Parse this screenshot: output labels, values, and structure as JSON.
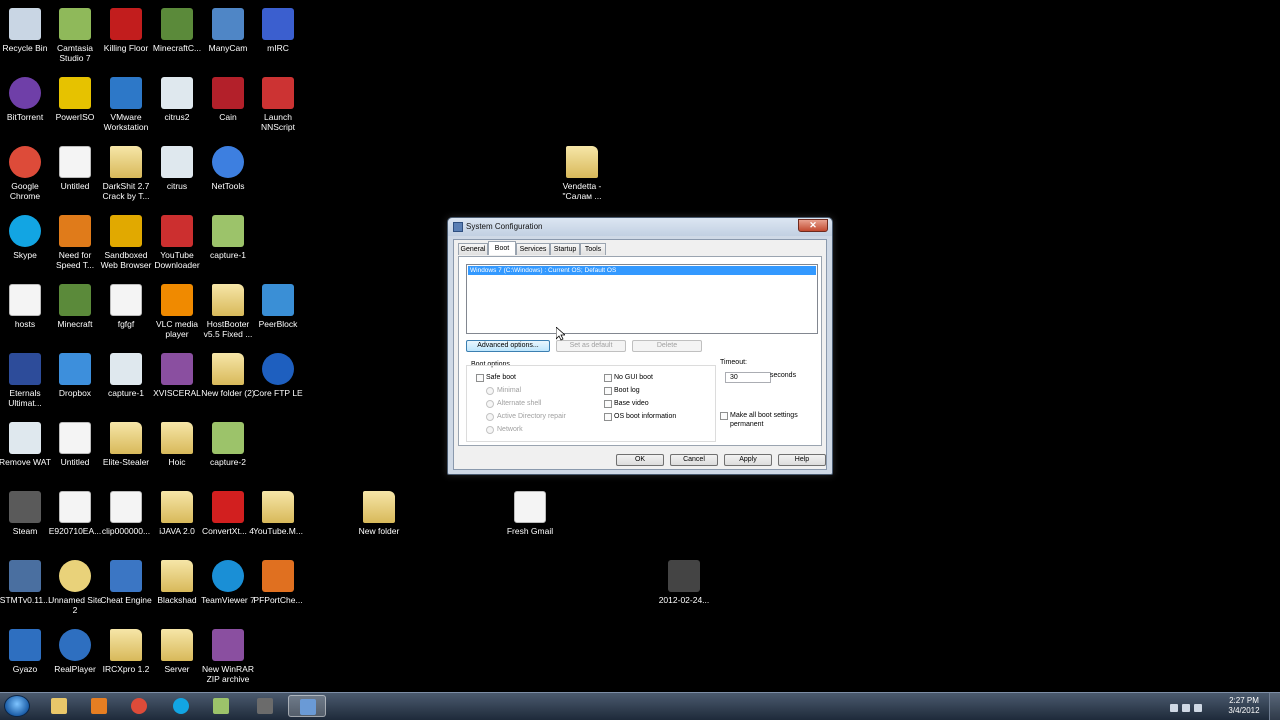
{
  "desktop_icons": [
    {
      "label": "Recycle Bin",
      "icon": "recycle-bin-icon",
      "color": "#c9d6e4"
    },
    {
      "label": "Camtasia Studio 7",
      "icon": "camtasia-icon",
      "color": "#8fb95a"
    },
    {
      "label": "Killing Floor",
      "icon": "killing-floor-icon",
      "color": "#c21d1d"
    },
    {
      "label": "MinecraftC...",
      "icon": "minecraft-icon",
      "color": "#5b8a3a"
    },
    {
      "label": "ManyCam",
      "icon": "manycam-icon",
      "color": "#4f86c6"
    },
    {
      "label": "mIRC",
      "icon": "mirc-icon",
      "color": "#3b5fcf"
    },
    {
      "label": "BitTorrent",
      "icon": "bittorrent-icon",
      "color": "#6f3fa8"
    },
    {
      "label": "PowerISO",
      "icon": "poweriso-icon",
      "color": "#e6c200"
    },
    {
      "label": "VMware Workstation",
      "icon": "vmware-icon",
      "color": "#2d78c8"
    },
    {
      "label": "citrus2",
      "icon": "window-file-icon",
      "color": "#dfe8ee"
    },
    {
      "label": "Cain",
      "icon": "cain-icon",
      "color": "#b3202a"
    },
    {
      "label": "Launch NNScript",
      "icon": "nnscript-icon",
      "color": "#c33"
    },
    {
      "label": "Google Chrome",
      "icon": "chrome-icon",
      "color": "#dd4b39"
    },
    {
      "label": "Untitled",
      "icon": "blank-file-icon",
      "color": "#ffffff"
    },
    {
      "label": "DarkShit 2.7 Crack by T...",
      "icon": "folder-icon",
      "color": "#e9d27a"
    },
    {
      "label": "citrus",
      "icon": "window-file-icon",
      "color": "#dfe8ee"
    },
    {
      "label": "NetTools",
      "icon": "globe-icon",
      "color": "#3d7fe0"
    },
    {
      "label": "Skype",
      "icon": "skype-icon",
      "color": "#12a5e3"
    },
    {
      "label": "Need for Speed T...",
      "icon": "nfs-icon",
      "color": "#e07b1a"
    },
    {
      "label": "Sandboxed Web Browser",
      "icon": "sandboxie-icon",
      "color": "#e1a900"
    },
    {
      "label": "YouTube Downloader",
      "icon": "youtube-downloader-icon",
      "color": "#cc2f2f"
    },
    {
      "label": "capture-1",
      "icon": "video-file-icon",
      "color": "#9cc36a"
    },
    {
      "label": "hosts",
      "icon": "blank-file-icon",
      "color": "#ffffff"
    },
    {
      "label": "Minecraft",
      "icon": "minecraft-icon",
      "color": "#5b8a3a"
    },
    {
      "label": "fgfgf",
      "icon": "blank-file-icon",
      "color": "#ffffff"
    },
    {
      "label": "VLC media player",
      "icon": "vlc-icon",
      "color": "#f08a00"
    },
    {
      "label": "HostBooter v5.5 Fixed ...",
      "icon": "folder-icon",
      "color": "#e9d27a"
    },
    {
      "label": "PeerBlock",
      "icon": "peerblock-icon",
      "color": "#3a8fd6"
    },
    {
      "label": "Eternals Ultimat...",
      "icon": "window-file-icon",
      "color": "#2d4c9a"
    },
    {
      "label": "Dropbox",
      "icon": "dropbox-icon",
      "color": "#3d8fdc"
    },
    {
      "label": "capture-1",
      "icon": "window-file-icon",
      "color": "#dfe8ee"
    },
    {
      "label": "XVISCERAL",
      "icon": "rar-icon",
      "color": "#8a4fa0"
    },
    {
      "label": "New folder (2)",
      "icon": "folder-icon",
      "color": "#e9d27a"
    },
    {
      "label": "Core FTP LE",
      "icon": "coreftp-icon",
      "color": "#1e5fbf"
    },
    {
      "label": "Remove WAT",
      "icon": "window-file-icon",
      "color": "#dfe8ee"
    },
    {
      "label": "Untitled",
      "icon": "blank-file-icon",
      "color": "#ffffff"
    },
    {
      "label": "Elite-Stealer",
      "icon": "folder-icon",
      "color": "#e9d27a"
    },
    {
      "label": "Hoic",
      "icon": "folder-icon",
      "color": "#e9d27a"
    },
    {
      "label": "capture-2",
      "icon": "video-file-icon",
      "color": "#9cc36a"
    },
    {
      "label": "Steam",
      "icon": "steam-icon",
      "color": "#5a5a5a"
    },
    {
      "label": "E920710EA...",
      "icon": "blank-file-icon",
      "color": "#ffffff"
    },
    {
      "label": "clip000000...",
      "icon": "blank-file-icon",
      "color": "#ffffff"
    },
    {
      "label": "iJAVA 2.0",
      "icon": "folder-icon",
      "color": "#e9d27a"
    },
    {
      "label": "ConvertXt... 4",
      "icon": "convertx-icon",
      "color": "#d21f1f"
    },
    {
      "label": "YouTube.M...",
      "icon": "folder-icon",
      "color": "#e9d27a"
    },
    {
      "label": "STMTv0.11...",
      "icon": "router-icon",
      "color": "#4a6fa0"
    },
    {
      "label": "Unnamed Site 2",
      "icon": "chrome-file-icon",
      "color": "#e9d27a"
    },
    {
      "label": "Cheat Engine",
      "icon": "cheat-engine-icon",
      "color": "#3b76c4"
    },
    {
      "label": "Blackshad",
      "icon": "folder-icon",
      "color": "#e9d27a"
    },
    {
      "label": "TeamViewer 7",
      "icon": "teamviewer-icon",
      "color": "#1a8fd6"
    },
    {
      "label": "PFPortChe...",
      "icon": "pfportcheck-icon",
      "color": "#e07020"
    },
    {
      "label": "Gyazo",
      "icon": "gyazo-icon",
      "color": "#2e6fc0"
    },
    {
      "label": "RealPlayer",
      "icon": "realplayer-icon",
      "color": "#2e6fc0"
    },
    {
      "label": "IRCXpro 1.2",
      "icon": "folder-icon",
      "color": "#e9d27a"
    },
    {
      "label": "Server",
      "icon": "folder-icon",
      "color": "#e9d27a"
    },
    {
      "label": "New WinRAR ZIP archive",
      "icon": "rar-icon",
      "color": "#8a4fa0"
    },
    {
      "label": "Vendetta - \"Салам ...",
      "icon": "folder-icon",
      "color": "#e9d27a"
    },
    {
      "label": "New folder",
      "icon": "folder-icon",
      "color": "#e9d27a"
    },
    {
      "label": "Fresh Gmail",
      "icon": "blank-file-icon",
      "color": "#ffffff"
    },
    {
      "label": "2012-02-24...",
      "icon": "video-file-icon",
      "color": "#444444"
    }
  ],
  "dialog": {
    "title": "System Configuration",
    "close": "✕",
    "tabs": [
      "General",
      "Boot",
      "Services",
      "Startup",
      "Tools"
    ],
    "os_entry": "Windows 7 (C:\\Windows) : Current OS; Default OS",
    "buttons": {
      "advanced": "Advanced options...",
      "set_default": "Set as default",
      "delete": "Delete"
    },
    "boot_options_label": "Boot options",
    "safe_boot": "Safe boot",
    "safe_boot_modes": [
      "Minimal",
      "Alternate shell",
      "Active Directory repair",
      "Network"
    ],
    "right_options": [
      "No GUI boot",
      "Boot log",
      "Base video",
      "OS boot information"
    ],
    "timeout_label": "Timeout:",
    "timeout_value": "30",
    "timeout_unit": "seconds",
    "make_permanent": "Make all boot settings permanent",
    "footer": {
      "ok": "OK",
      "cancel": "Cancel",
      "apply": "Apply",
      "help": "Help"
    }
  },
  "taskbar": {
    "items": [
      {
        "icon": "explorer-icon",
        "color": "#e9c76a"
      },
      {
        "icon": "media-player-icon",
        "color": "#e67e22"
      },
      {
        "icon": "chrome-icon",
        "color": "#dd4b39"
      },
      {
        "icon": "skype-icon",
        "color": "#12a5e3"
      },
      {
        "icon": "camtasia-icon",
        "color": "#9cc36a"
      },
      {
        "icon": "recorder-icon",
        "color": "#6b6b6b"
      },
      {
        "icon": "msconfig-icon",
        "color": "#6a9ad6"
      }
    ],
    "time": "2:27 PM",
    "date": "3/4/2012"
  }
}
